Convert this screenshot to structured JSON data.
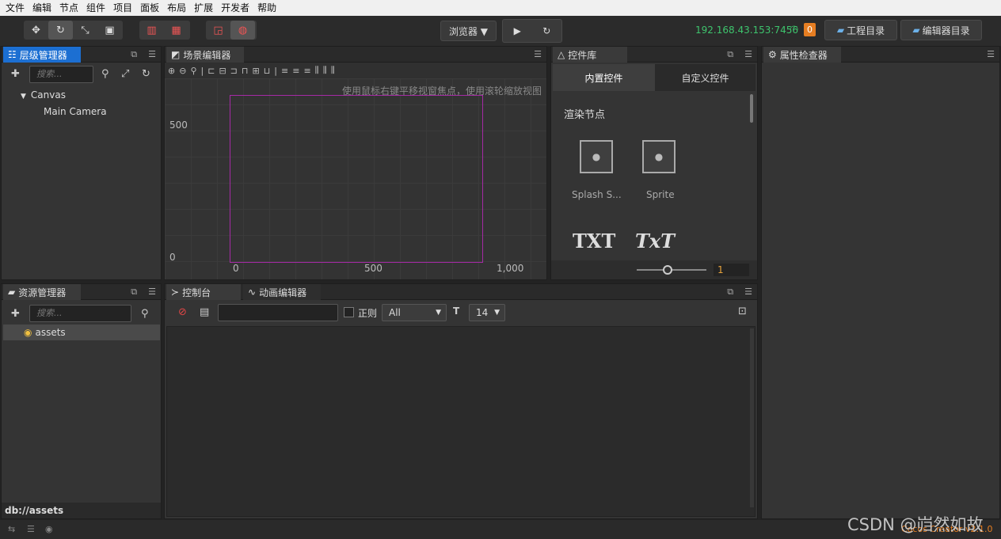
{
  "menu": [
    "文件",
    "编辑",
    "节点",
    "组件",
    "项目",
    "面板",
    "布局",
    "扩展",
    "开发者",
    "帮助"
  ],
  "toolbar": {
    "browser_label": "浏览器 ▼",
    "ip": "192.168.43.153:7456",
    "badge": "0",
    "project_dir": "工程目录",
    "editor_dir": "编辑器目录"
  },
  "hierarchy": {
    "title": "层级管理器",
    "search_placeholder": "搜索...",
    "root": "Canvas",
    "child": "Main Camera"
  },
  "scene": {
    "title": "场景编辑器",
    "hint": "使用鼠标右键平移视窗焦点，使用滚轮缩放视图",
    "y500": "500",
    "y0": "0",
    "x0": "0",
    "x500": "500",
    "x1000": "1,000"
  },
  "widgets": {
    "title": "控件库",
    "tab_builtin": "内置控件",
    "tab_custom": "自定义控件",
    "section": "渲染节点",
    "items": [
      "Splash S...",
      "Sprite"
    ],
    "txt1": "TXT",
    "txt2": "TxT",
    "slider_value": "1"
  },
  "inspector": {
    "title": "属性检查器"
  },
  "assets": {
    "title": "资源管理器",
    "search_placeholder": "搜索...",
    "root": "assets",
    "footer": "db://assets"
  },
  "console": {
    "tab_console": "控制台",
    "tab_anim": "动画编辑器",
    "regex_label": "正则",
    "filter": "All",
    "font_size": "14"
  },
  "footer": {
    "version": "Cocos Creator v2.1.0",
    "watermark": "CSDN @岿然如故"
  }
}
